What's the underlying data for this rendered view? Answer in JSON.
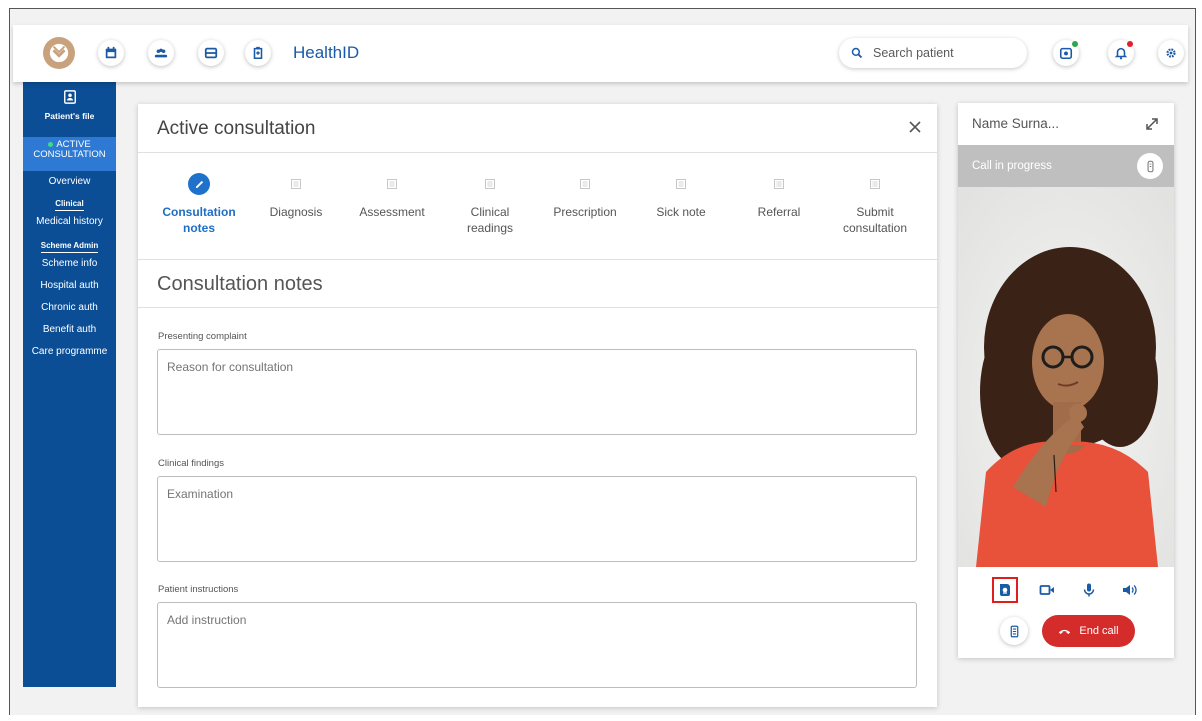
{
  "app": {
    "title": "HealthID"
  },
  "search": {
    "placeholder": "Search patient"
  },
  "sidebar": {
    "header": "Patient's file",
    "active_status": "ACTIVE",
    "active_label": "CONSULTATION",
    "overview": "Overview",
    "clinical_section": "Clinical",
    "clinical_items": [
      "Medical history"
    ],
    "scheme_section": "Scheme Admin",
    "scheme_items": [
      "Scheme info",
      "Hospital auth",
      "Chronic auth",
      "Benefit auth",
      "Care programme"
    ]
  },
  "consultation": {
    "title": "Active consultation",
    "steps": [
      {
        "label": "Consultation notes",
        "active": true
      },
      {
        "label": "Diagnosis",
        "active": false
      },
      {
        "label": "Assessment",
        "active": false
      },
      {
        "label": "Clinical readings",
        "active": false
      },
      {
        "label": "Prescription",
        "active": false
      },
      {
        "label": "Sick note",
        "active": false
      },
      {
        "label": "Referral",
        "active": false
      },
      {
        "label": "Submit consultation",
        "active": false
      }
    ],
    "section_title": "Consultation notes",
    "fields": [
      {
        "label": "Presenting complaint",
        "placeholder": "Reason for consultation",
        "value": ""
      },
      {
        "label": "Clinical findings",
        "placeholder": "Examination",
        "value": ""
      },
      {
        "label": "Patient instructions",
        "placeholder": "Add instruction",
        "value": ""
      }
    ]
  },
  "video_call": {
    "caller_name": "Name Surna...",
    "status": "Call in progress",
    "end_call_label": "End call"
  },
  "colors": {
    "primary": "#1e6ec4",
    "sidebar": "#0b4e96",
    "sidebar_active": "#2d79d3",
    "end_call": "#d42b2b",
    "status_bar": "#bfbfbf",
    "highlight": "#e01e1e"
  }
}
